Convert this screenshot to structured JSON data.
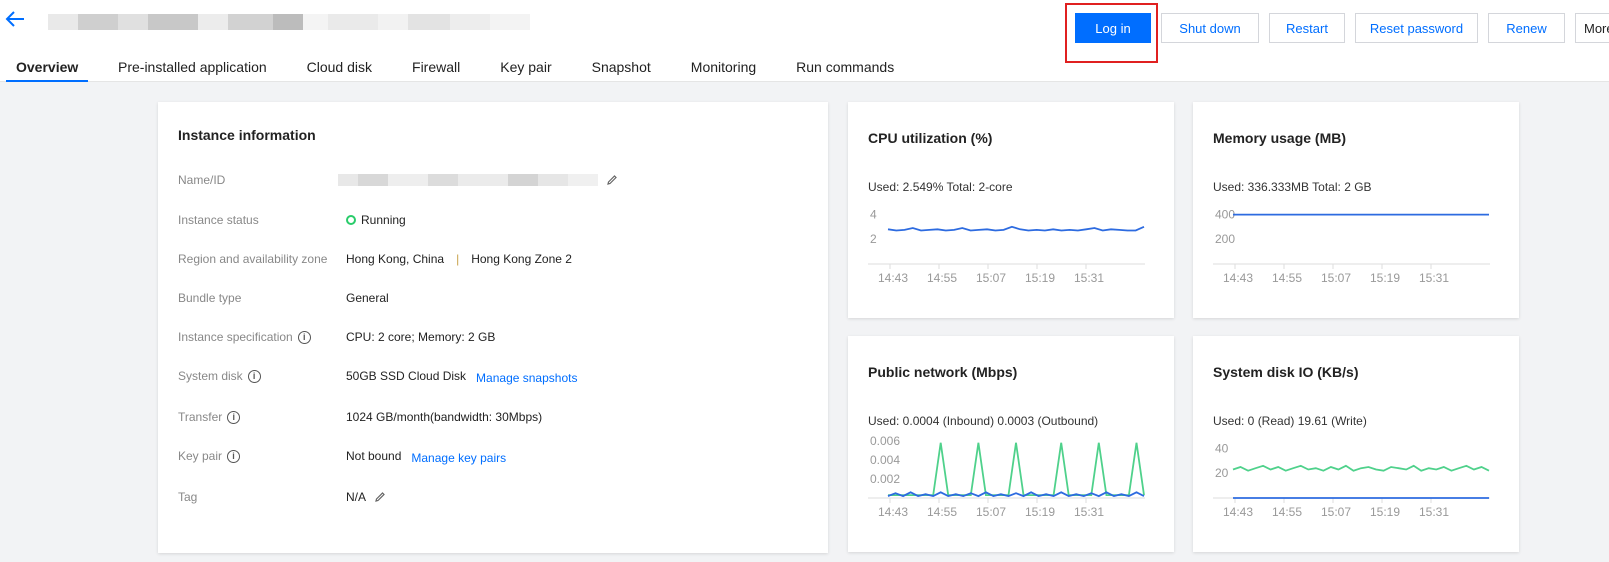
{
  "header": {
    "back_icon": "arrow-left-icon",
    "buttons": {
      "login": "Log in",
      "shutdown": "Shut down",
      "restart": "Restart",
      "reset_password": "Reset password",
      "renew": "Renew",
      "more": "More"
    }
  },
  "tabs": [
    "Overview",
    "Pre-installed application",
    "Cloud disk",
    "Firewall",
    "Key pair",
    "Snapshot",
    "Monitoring",
    "Run commands"
  ],
  "instance": {
    "title": "Instance information",
    "labels": {
      "name": "Name/ID",
      "status": "Instance status",
      "region": "Region and availability zone",
      "bundle": "Bundle type",
      "spec": "Instance specification",
      "disk": "System disk",
      "transfer": "Transfer",
      "keypair": "Key pair",
      "tag": "Tag"
    },
    "values": {
      "status": "Running",
      "region": "Hong Kong, China",
      "zone": "Hong Kong Zone 2",
      "bundle": "General",
      "spec": "CPU: 2 core; Memory: 2 GB",
      "disk": "50GB SSD Cloud Disk",
      "transfer": "1024 GB/month(bandwidth: 30Mbps)",
      "keypair": "Not bound",
      "tag": "N/A"
    },
    "links": {
      "snapshots": "Manage snapshots",
      "keypairs": "Manage key pairs"
    },
    "divider": "|"
  },
  "metrics": {
    "cpu": {
      "title": "CPU utilization (%)",
      "used": "Used: 2.549% Total: 2-core"
    },
    "memory": {
      "title": "Memory usage (MB)",
      "used": "Used: 336.333MB Total: 2 GB"
    },
    "network": {
      "title": "Public network (Mbps)",
      "used": "Used: 0.0004 (Inbound) 0.0003 (Outbound)"
    },
    "disk": {
      "title": "System disk IO (KB/s)",
      "used": "Used: 0 (Read) 19.61 (Write)"
    }
  },
  "colors": {
    "accent": "#006eff",
    "highlight": "#e02020",
    "running": "#29cc6a",
    "series_green": "#4fd18b"
  },
  "chart_data": [
    {
      "type": "line",
      "x": [
        "14:43",
        "14:55",
        "15:07",
        "15:19",
        "15:31"
      ],
      "ylim": [
        0,
        5
      ],
      "yticks": [
        "4",
        "2"
      ],
      "ytick_values": [
        4,
        2
      ],
      "series": [
        {
          "color": "#2d6be0",
          "values": [
            2.8,
            2.7,
            2.75,
            2.9,
            2.7,
            2.75,
            2.8,
            2.7,
            2.75,
            2.9,
            2.7,
            2.75,
            2.8,
            2.7,
            2.75,
            3.0,
            2.8,
            2.7,
            2.75,
            2.7,
            2.8,
            2.7,
            2.75,
            2.7,
            2.8,
            2.9,
            2.7,
            2.8,
            2.75,
            2.7,
            2.7,
            3.0
          ]
        }
      ]
    },
    {
      "type": "line",
      "x": [
        "14:43",
        "14:55",
        "15:07",
        "15:19",
        "15:31"
      ],
      "ylim": [
        0,
        500
      ],
      "yticks": [
        "400",
        "200"
      ],
      "ytick_values": [
        400,
        200
      ],
      "series": [
        {
          "color": "#2d6be0",
          "values": [
            398,
            398,
            398,
            398,
            398,
            398,
            398,
            398,
            398,
            398,
            398,
            398,
            398,
            398,
            398,
            398
          ]
        }
      ]
    },
    {
      "type": "line",
      "x": [
        "14:43",
        "14:55",
        "15:07",
        "15:19",
        "15:31"
      ],
      "ylim": [
        0,
        0.0065
      ],
      "yticks": [
        "0.006",
        "0.004",
        "0.002"
      ],
      "ytick_values": [
        0.006,
        0.004,
        0.002
      ],
      "series": [
        {
          "color": "#4fd18b",
          "values": [
            0.0003,
            0.0003,
            0.0003,
            0.0003,
            0.0003,
            0.0003,
            0.0003,
            0.0058,
            0.0003,
            0.0003,
            0.0003,
            0.0003,
            0.0058,
            0.0003,
            0.0003,
            0.0003,
            0.0003,
            0.0058,
            0.0003,
            0.0003,
            0.0003,
            0.0003,
            0.0003,
            0.0058,
            0.0003,
            0.0003,
            0.0003,
            0.0003,
            0.0058,
            0.0003,
            0.0003,
            0.0003,
            0.0003,
            0.0058,
            0.0003
          ]
        },
        {
          "color": "#2d6be0",
          "values": [
            0.0002,
            0.0005,
            0.0002,
            0.0006,
            0.0002,
            0.0004,
            0.0002,
            0.0006,
            0.0002,
            0.0004,
            0.0002,
            0.0005,
            0.0002,
            0.0006,
            0.0002,
            0.0004,
            0.0002,
            0.0005,
            0.0002,
            0.0006,
            0.0002,
            0.0004,
            0.0002,
            0.0006,
            0.0002,
            0.0004,
            0.0002,
            0.0005,
            0.0002,
            0.0006,
            0.0002,
            0.0004,
            0.0002,
            0.0006,
            0.0002
          ]
        }
      ]
    },
    {
      "type": "line",
      "x": [
        "14:43",
        "14:55",
        "15:07",
        "15:19",
        "15:31"
      ],
      "ylim": [
        0,
        50
      ],
      "yticks": [
        "40",
        "20"
      ],
      "ytick_values": [
        40,
        20
      ],
      "series": [
        {
          "color": "#4fd18b",
          "values": [
            23,
            25,
            22,
            24,
            26,
            23,
            25,
            22,
            24,
            26,
            23,
            24,
            22,
            25,
            23,
            26,
            22,
            24,
            25,
            23,
            22,
            25,
            24,
            23,
            26,
            22,
            24,
            23,
            25,
            22,
            24,
            26,
            23,
            25,
            22
          ]
        },
        {
          "color": "#2d6be0",
          "values": [
            0,
            0,
            0,
            0,
            0,
            0,
            0,
            0,
            0,
            0,
            0,
            0,
            0,
            0,
            0,
            0
          ]
        }
      ]
    }
  ]
}
